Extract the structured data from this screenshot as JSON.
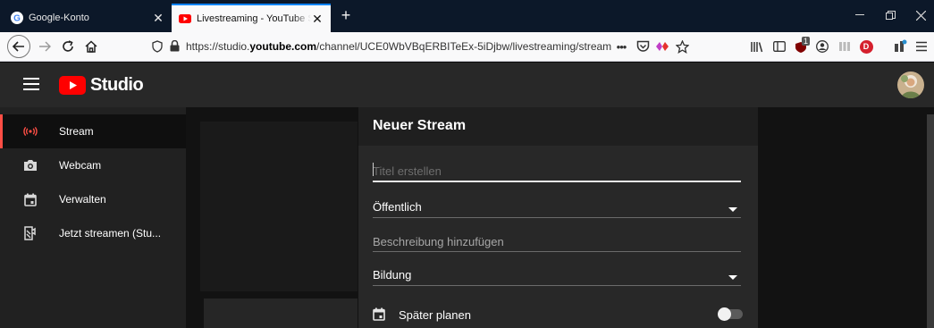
{
  "browser": {
    "tabs": [
      {
        "title": "Google-Konto",
        "close": "✕"
      },
      {
        "title": "Livestreaming - YouTube Studio",
        "close": "✕"
      }
    ],
    "new_tab": "+",
    "url": {
      "prefix": "https://studio.",
      "domain": "youtube.com",
      "path": "/channel/UCE0WbVBqERBITeEx-5iDjbw/livestreaming/stream"
    },
    "page_actions": "•••",
    "extension_badge": "1",
    "extension_letter": "D"
  },
  "studio": {
    "logo_word": "Studio",
    "sidebar": {
      "items": [
        {
          "label": "Stream",
          "icon": "live-icon"
        },
        {
          "label": "Webcam",
          "icon": "camera-icon"
        },
        {
          "label": "Verwalten",
          "icon": "calendar-icon"
        },
        {
          "label": "Jetzt streamen (Stu...",
          "icon": "stream-now-icon"
        }
      ]
    },
    "dialog": {
      "title": "Neuer Stream",
      "title_placeholder": "Titel erstellen",
      "visibility": "Öffentlich",
      "description_placeholder": "Beschreibung hinzufügen",
      "category": "Bildung",
      "schedule_label": "Später planen",
      "schedule_enabled": false
    }
  },
  "colors": {
    "accent_red": "#ff0000",
    "active_indicator": "#ff4e45",
    "firefox_blue": "#0a84ff"
  }
}
